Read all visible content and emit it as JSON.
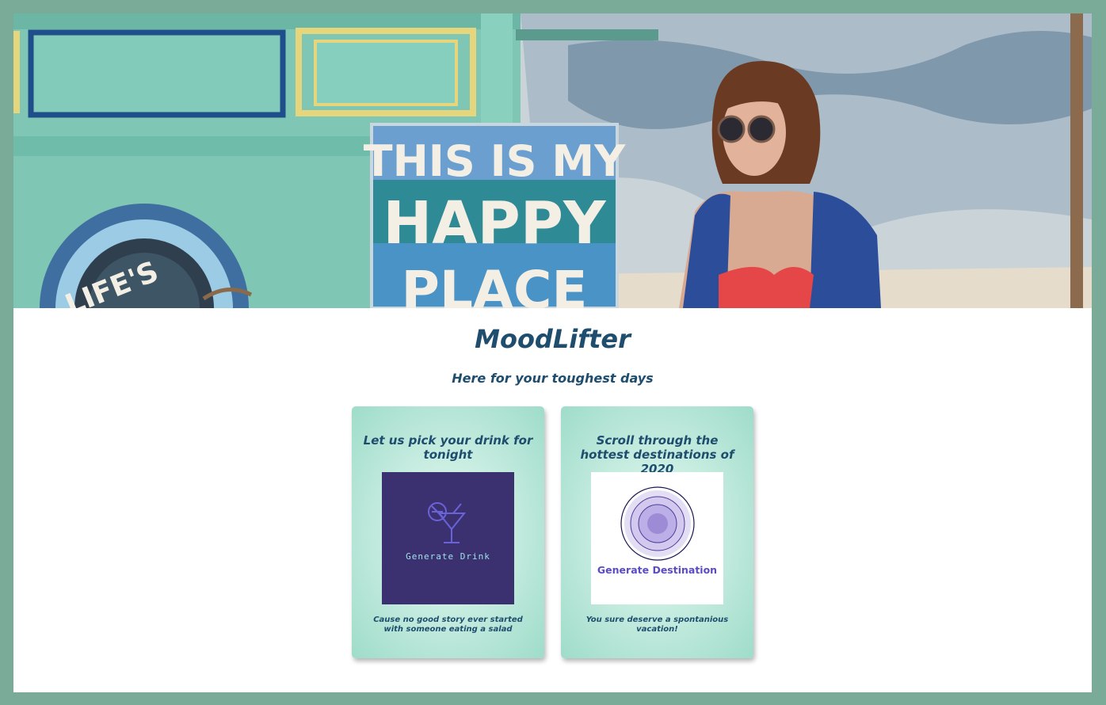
{
  "hero": {
    "sign_lines": [
      "THIS IS MY",
      "HAPPY",
      "PLACE"
    ],
    "wheel_text": "LIFE'S"
  },
  "header": {
    "title": "MoodLifter",
    "subtitle": "Here for your toughest days"
  },
  "cards": [
    {
      "heading": "Let us pick your drink for tonight",
      "image_label": "Generate Drink",
      "image_icon": "cocktail-glass-icon",
      "caption": "Cause no good story ever started with someone eating a salad",
      "image_bg": "#3b3170"
    },
    {
      "heading": "Scroll through the hottest destinations of 2020",
      "image_label": "Generate Destination",
      "image_icon": "concentric-circles-icon",
      "caption": "You sure deserve a spontanious vacation!",
      "image_bg": "#ffffff"
    }
  ],
  "colors": {
    "frame": "#7aab98",
    "heading_text": "#1f4d6e",
    "card_gradient_center": "#e6f7f1",
    "card_gradient_edge": "#9fdcc9"
  }
}
